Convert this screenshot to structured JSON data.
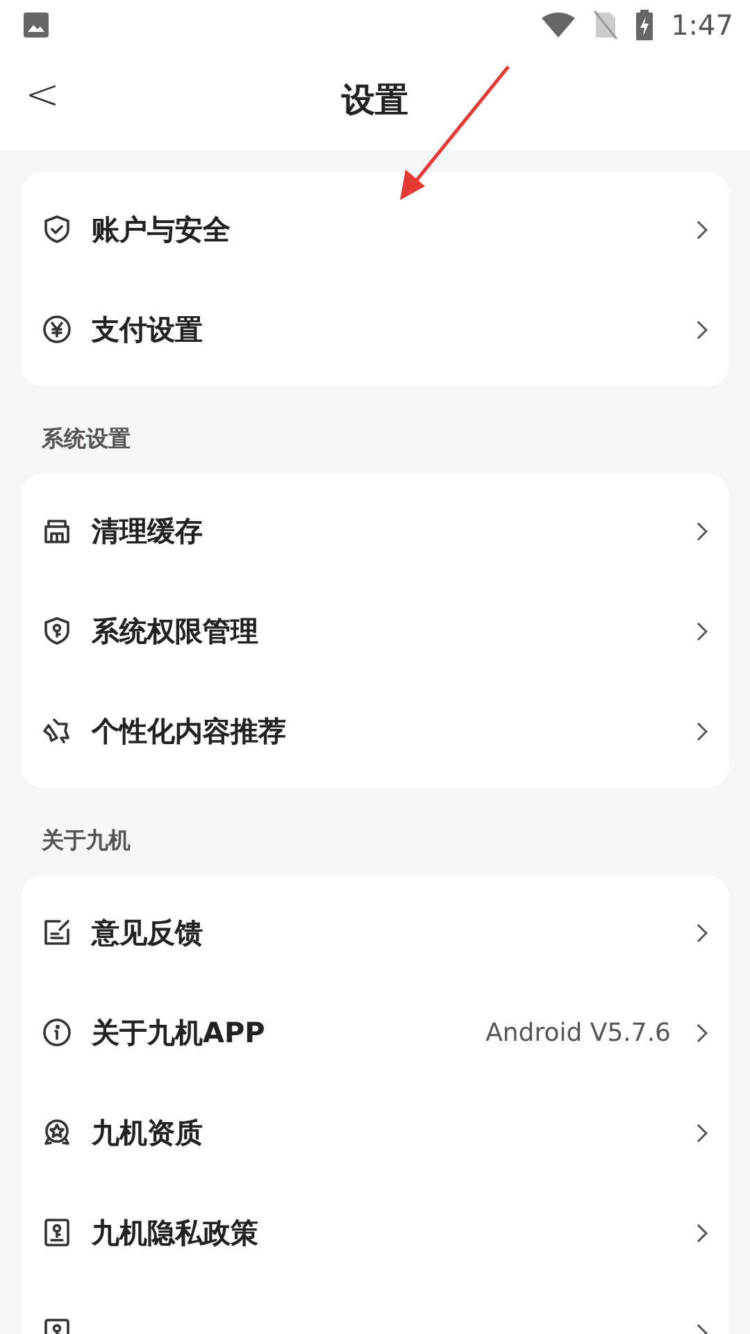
{
  "status_bar": {
    "time": "1:47"
  },
  "header": {
    "back": "<",
    "title": "设置"
  },
  "sections": [
    {
      "items": [
        {
          "label": "账户与安全"
        },
        {
          "label": "支付设置"
        }
      ]
    },
    {
      "title": "系统设置",
      "items": [
        {
          "label": "清理缓存"
        },
        {
          "label": "系统权限管理"
        },
        {
          "label": "个性化内容推荐"
        }
      ]
    },
    {
      "title": "关于九机",
      "items": [
        {
          "label": "意见反馈"
        },
        {
          "label": "关于九机APP",
          "value": "Android V5.7.6"
        },
        {
          "label": "九机资质"
        },
        {
          "label": "九机隐私政策"
        }
      ],
      "partial_row_below": true
    }
  ]
}
